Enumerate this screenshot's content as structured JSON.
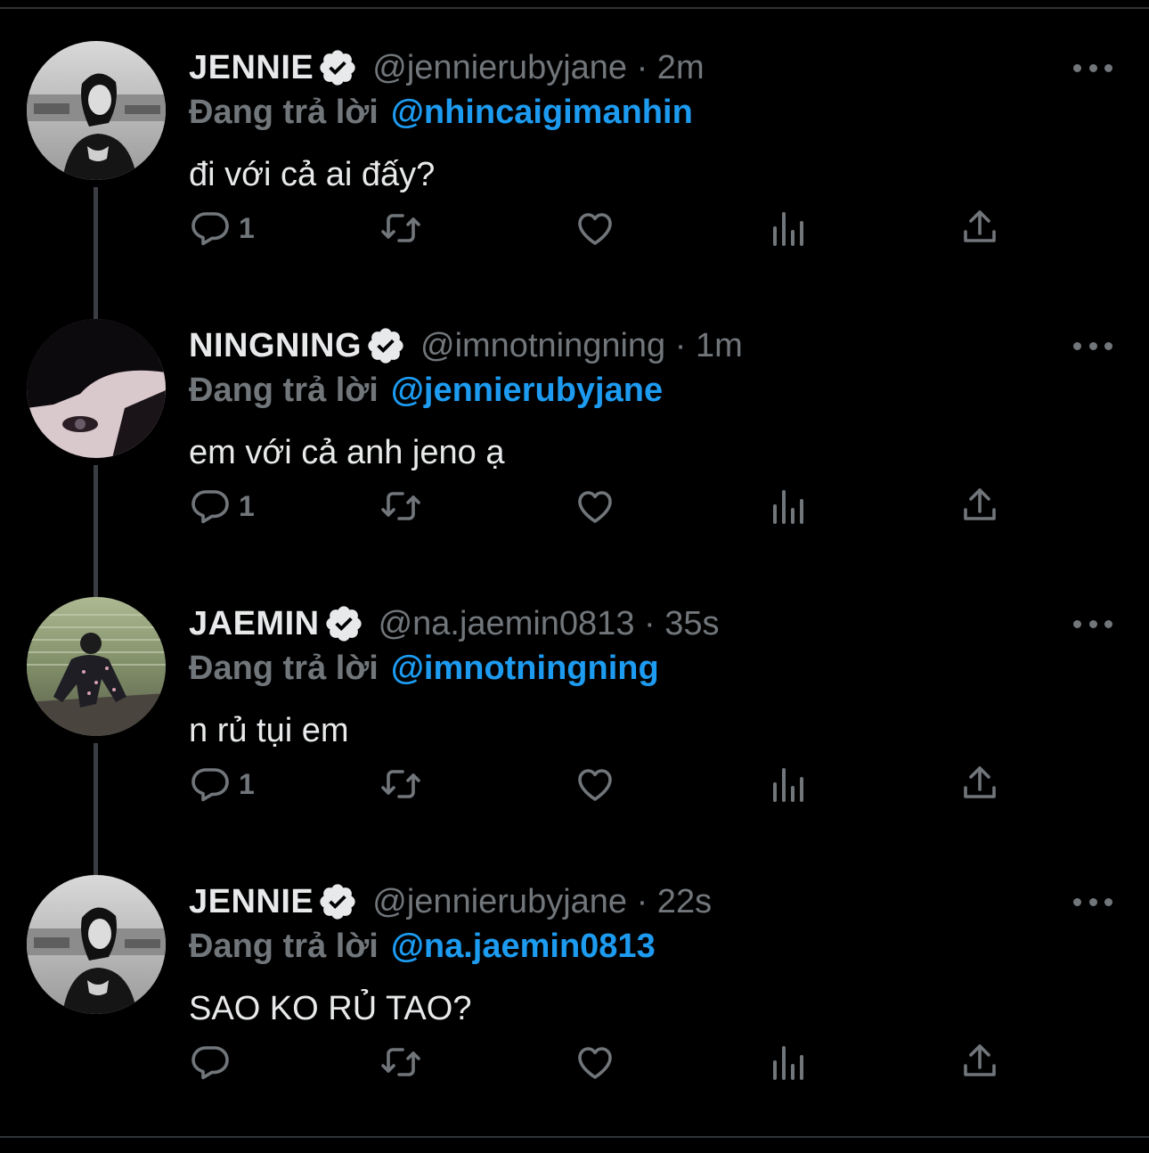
{
  "tweets": [
    {
      "name": "JENNIE",
      "handle": "@jennierubyjane · 2m",
      "reply_prefix": "Đang trả lời",
      "reply_target": "@nhincaigimanhin",
      "text": "đi với cả ai đấy?",
      "reply_count": "1",
      "avatar": "avatar-jennie"
    },
    {
      "name": "NINGNING",
      "handle": "@imnotningning · 1m",
      "reply_prefix": "Đang trả lời",
      "reply_target": "@jennierubyjane",
      "text": "em với cả anh jeno ạ",
      "reply_count": "1",
      "avatar": "avatar-ningning"
    },
    {
      "name": "JAEMIN",
      "handle": "@na.jaemin0813 · 35s",
      "reply_prefix": "Đang trả lời",
      "reply_target": "@imnotningning",
      "text": "n rủ tụi em",
      "reply_count": "1",
      "avatar": "avatar-jaemin"
    },
    {
      "name": "JENNIE",
      "handle": "@jennierubyjane · 22s",
      "reply_prefix": "Đang trả lời",
      "reply_target": "@na.jaemin0813",
      "text": "SAO KO RỦ TAO?",
      "reply_count": "",
      "avatar": "avatar-jennie"
    }
  ],
  "icons": {
    "verified": "verified-badge-icon",
    "more": "more-icon",
    "reply": "reply-icon",
    "retweet": "retweet-icon",
    "like": "like-icon",
    "analytics": "analytics-icon",
    "share": "share-icon"
  },
  "colors": {
    "background": "#000000",
    "text": "#e7e9ea",
    "muted": "#71767b",
    "link": "#1d9bf0",
    "thread_line": "#3a3e42"
  }
}
